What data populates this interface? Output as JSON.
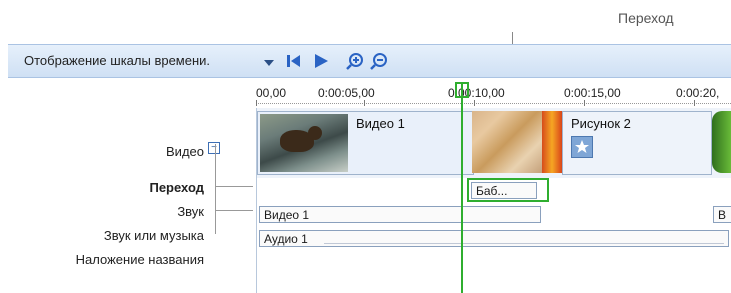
{
  "callout": {
    "label": "Переход"
  },
  "toolbar": {
    "view_label": "Отображение шкалы времени.",
    "icons": [
      "dropdown-arrow-icon",
      "skip-to-start-icon",
      "play-icon",
      "zoom-in-icon",
      "zoom-out-icon"
    ]
  },
  "ruler": {
    "ticks": [
      "00,00",
      "0:00:05,00",
      "0:00:10,00",
      "0:00:15,00",
      "0:00:20,"
    ]
  },
  "tracks": {
    "video": "Видео",
    "transition": "Переход",
    "audio": "Звук",
    "music": "Звук или музыка",
    "title_overlay": "Наложение названия"
  },
  "clips": {
    "video1": "Видео 1",
    "picture2": "Рисунок 2",
    "transition": "Баб...",
    "audio_main": "Видео 1",
    "audio_right": "В",
    "music": "Аудио 1"
  },
  "colors": {
    "playhead": "#2fae2f",
    "toolbar": "#cfe0f4",
    "accent": "#2a5aa0"
  }
}
